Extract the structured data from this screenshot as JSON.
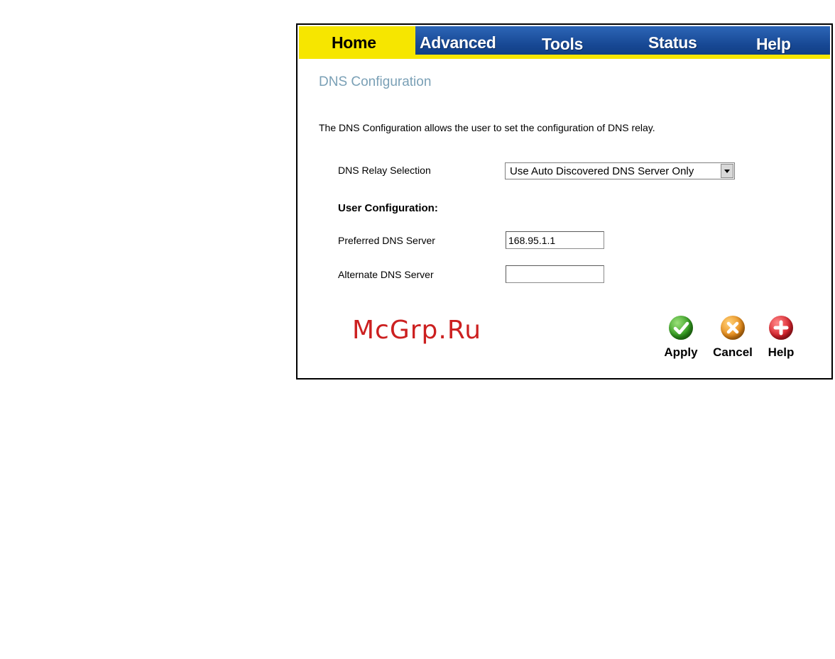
{
  "nav": {
    "tabs": [
      {
        "label": "Home",
        "active": true
      },
      {
        "label": "Advanced",
        "active": false
      },
      {
        "label": "Tools",
        "active": false
      },
      {
        "label": "Status",
        "active": false
      },
      {
        "label": "Help",
        "active": false
      }
    ]
  },
  "page": {
    "title": "DNS Configuration",
    "description": "The DNS Configuration allows the user to set the configuration of DNS relay."
  },
  "form": {
    "relay_label": "DNS Relay Selection",
    "relay_value": "Use Auto Discovered DNS Server Only",
    "user_config_heading": "User Configuration:",
    "preferred_label": "Preferred DNS Server",
    "preferred_value": "168.95.1.1",
    "alternate_label": "Alternate DNS Server",
    "alternate_value": ""
  },
  "actions": {
    "apply_label": "Apply",
    "cancel_label": "Cancel",
    "help_label": "Help"
  },
  "watermark": "McGrp.Ru",
  "colors": {
    "tab_active": "#f6e600",
    "tab_inactive": "#1a50a0",
    "title": "#7aa0b6",
    "apply": "#2f9a1c",
    "cancel": "#e88a16",
    "help": "#d8202a"
  }
}
